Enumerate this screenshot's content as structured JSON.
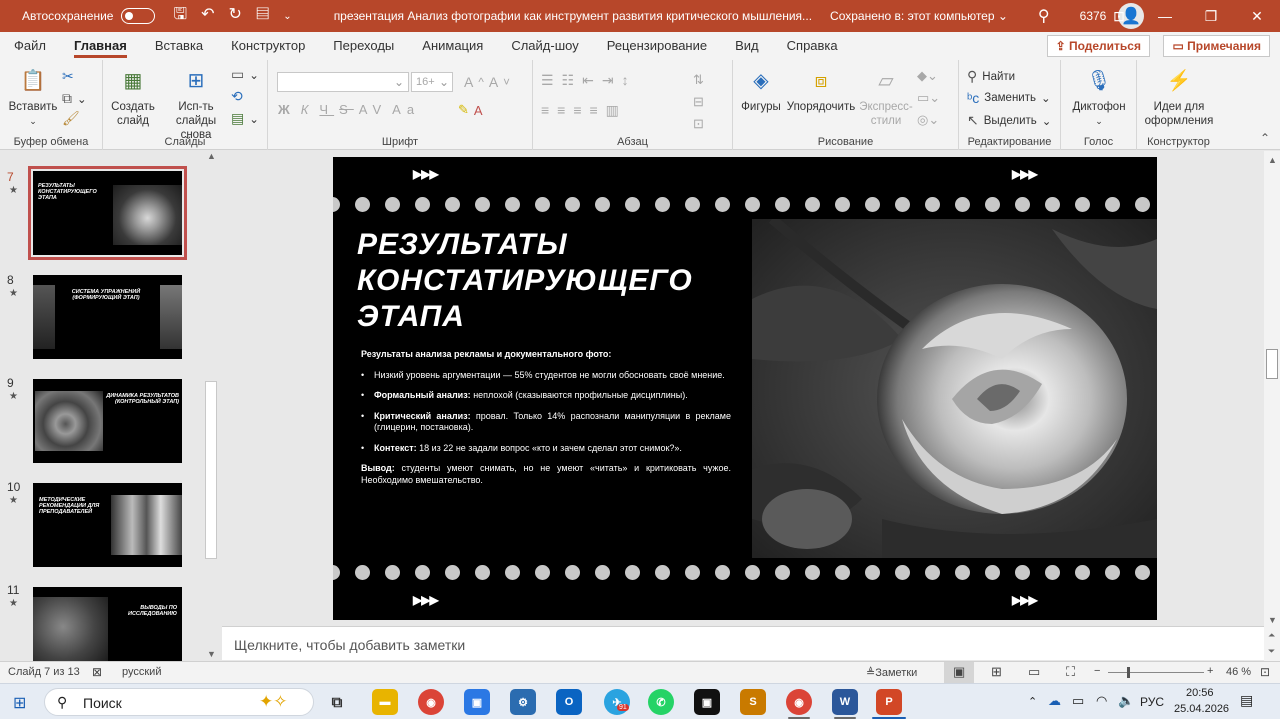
{
  "titlebar": {
    "autosave": "Автосохранение",
    "document": "презентация Анализ фотографии как инструмент развития критического мышления...",
    "saved": "Сохранено в: этот компьютер",
    "user_count": "6376"
  },
  "tabs": [
    "Файл",
    "Главная",
    "Вставка",
    "Конструктор",
    "Переходы",
    "Анимация",
    "Слайд-шоу",
    "Рецензирование",
    "Вид",
    "Справка"
  ],
  "actions": {
    "share": "Поделиться",
    "comments": "Примечания"
  },
  "ribbon": {
    "clipboard": {
      "paste": "Вставить",
      "label": "Буфер обмена"
    },
    "slides": {
      "new_slide": "Создать слайд",
      "from_outline": "Исп-ть слайды снова",
      "label": "Слайды"
    },
    "font": {
      "size": "16+",
      "label": "Шрифт",
      "bold": "Ж",
      "italic": "К",
      "underline": "Ч",
      "strike": "S",
      "spacing": "AV",
      "case": "Aa"
    },
    "paragraph": {
      "label": "Абзац"
    },
    "drawing": {
      "shapes": "Фигуры",
      "arrange": "Упорядочить",
      "styles": "Экспресс-стили",
      "label": "Рисование"
    },
    "editing": {
      "find": "Найти",
      "replace": "Заменить",
      "select": "Выделить",
      "label": "Редактирование"
    },
    "voice": {
      "dictate": "Диктофон",
      "label": "Голос"
    },
    "designer": {
      "ideas": "Идеи для оформления",
      "label": "Конструктор"
    }
  },
  "thumbnails": [
    {
      "num": "7",
      "title": "РЕЗУЛЬТАТЫ КОНСТАТИРУЮЩЕГО ЭТАПА"
    },
    {
      "num": "8",
      "title": "СИСТЕМА УПРАЖНЕНИЙ (ФОРМИРУЮЩИЙ ЭТАП)"
    },
    {
      "num": "9",
      "title": "ДИНАМИКА РЕЗУЛЬТАТОВ (КОНТРОЛЬНЫЙ ЭТАП)"
    },
    {
      "num": "10",
      "title": "МЕТОДИЧЕСКИЕ РЕКОМЕНДАЦИИ ДЛЯ ПРЕПОДАВАТЕЛЕЙ"
    },
    {
      "num": "11",
      "title": "ВЫВОДЫ ПО ИССЛЕДОВАНИЮ"
    }
  ],
  "slide": {
    "arrows": "▶▶▶",
    "title_lines": [
      "РЕЗУЛЬТАТЫ",
      "КОНСТАТИРУЮЩЕГО",
      "ЭТАПА"
    ],
    "intro": "Результаты анализа рекламы и документального фото:",
    "bullets": [
      {
        "bold": "",
        "text": "Низкий уровень аргументации — 55% студентов не могли обосновать своё мнение."
      },
      {
        "bold": "Формальный анализ:",
        "text": " неплохой (сказываются профильные дисциплины)."
      },
      {
        "bold": "Критический анализ:",
        "text": " провал. Только 14% распознали манипуляции в рекламе (глицерин, постановка)."
      },
      {
        "bold": "Контекст:",
        "text": " 18 из 22 не задали вопрос «кто и зачем сделал этот снимок?»."
      }
    ],
    "conclusion_bold": "Вывод:",
    "conclusion": " студенты умеют снимать, но не умеют «читать» и критиковать чужое. Необходимо вмешательство."
  },
  "notes_placeholder": "Щелкните, чтобы добавить заметки",
  "status": {
    "slide": "Слайд 7 из 13",
    "language": "русский",
    "notes": "Заметки",
    "zoom": "46 %"
  },
  "taskbar": {
    "search": "Поиск",
    "language": "РУС",
    "time": "20:56",
    "date": "25.04.2026",
    "telegram_badge": "91"
  }
}
